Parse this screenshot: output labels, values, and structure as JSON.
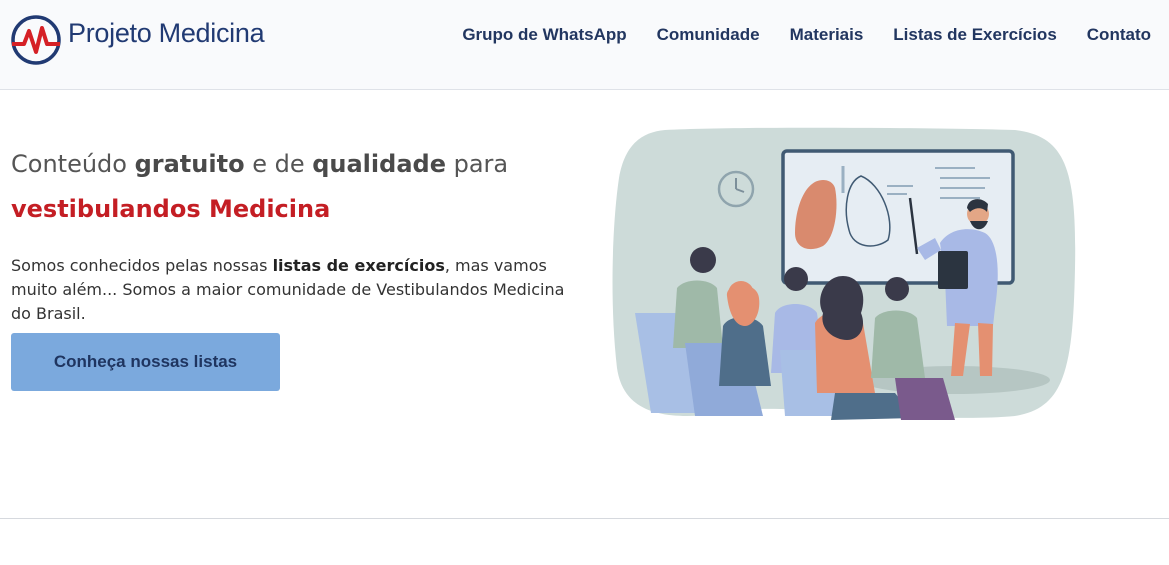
{
  "header": {
    "brand": "Projeto Medicina",
    "nav": [
      {
        "label": "Grupo de WhatsApp"
      },
      {
        "label": "Comunidade"
      },
      {
        "label": "Materiais"
      },
      {
        "label": "Listas de Exercícios"
      },
      {
        "label": "Contato"
      }
    ]
  },
  "hero": {
    "title_part1": "Conteúdo ",
    "title_bold1": "gratuito",
    "title_part2": " e de ",
    "title_bold2": "qualidade",
    "title_part3": " para",
    "subtitle": "vestibulandos Medicina",
    "text_part1": "Somos conhecidos pelas nossas ",
    "text_bold": "listas de exercícios",
    "text_part2": ", mas vamos muito além... Somos a maior comunidade de Vestibulandos Medicina do Brasil.",
    "cta_label": "Conheça nossas listas"
  },
  "icons": {
    "logo": "heartbeat-logo-icon",
    "illustration": "doctor-lecture-illustration"
  },
  "colors": {
    "brand_blue": "#213a73",
    "accent_red": "#c41e24",
    "cta_blue": "#7ba9dd",
    "header_bg": "#f9fafc"
  }
}
